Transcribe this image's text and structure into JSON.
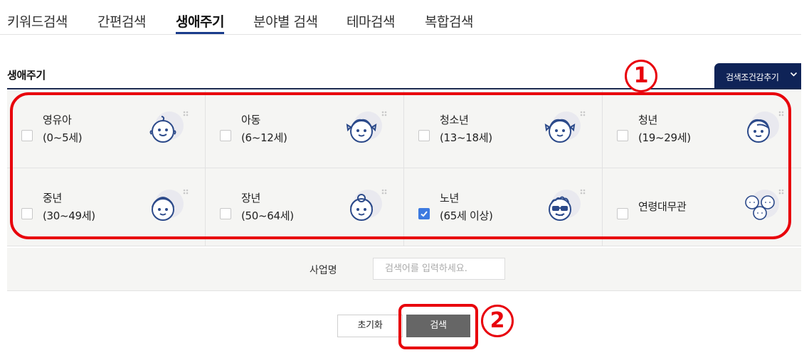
{
  "tabs": [
    {
      "label": "키워드검색",
      "active": false
    },
    {
      "label": "간편검색",
      "active": false
    },
    {
      "label": "생애주기",
      "active": true
    },
    {
      "label": "분야별 검색",
      "active": false
    },
    {
      "label": "테마검색",
      "active": false
    },
    {
      "label": "복합검색",
      "active": false
    }
  ],
  "section": {
    "title": "생애주기",
    "fold_button_label": "검색조건감추기"
  },
  "lifecycle": [
    {
      "name": "영유아",
      "age": "(0~5세)",
      "checked": false,
      "icon": "infant-face-icon"
    },
    {
      "name": "아동",
      "age": "(6~12세)",
      "checked": false,
      "icon": "child-face-icon"
    },
    {
      "name": "청소년",
      "age": "(13~18세)",
      "checked": false,
      "icon": "teen-face-icon"
    },
    {
      "name": "청년",
      "age": "(19~29세)",
      "checked": false,
      "icon": "young-adult-face-icon"
    },
    {
      "name": "중년",
      "age": "(30~49세)",
      "checked": false,
      "icon": "middle-aged-face-icon"
    },
    {
      "name": "장년",
      "age": "(50~64세)",
      "checked": false,
      "icon": "mature-face-icon"
    },
    {
      "name": "노년",
      "age": "(65세 이상)",
      "checked": true,
      "icon": "senior-face-icon"
    },
    {
      "name": "연령대무관",
      "age": "",
      "checked": false,
      "icon": "all-ages-faces-icon"
    }
  ],
  "business_name": {
    "label": "사업명",
    "placeholder": "검색어를 입력하세요.",
    "value": ""
  },
  "buttons": {
    "reset": "초기화",
    "search": "검색"
  },
  "annotations": {
    "marker1": "1",
    "marker2": "2"
  },
  "colors": {
    "accent_navy": "#0f2357",
    "tab_underline": "#1a3c8c",
    "annotation_red": "#e8000b",
    "checkbox_checked": "#3d7ae0",
    "search_button": "#666666",
    "icon_stroke": "#2c4a8a",
    "icon_bg": "#e9e9ef"
  }
}
